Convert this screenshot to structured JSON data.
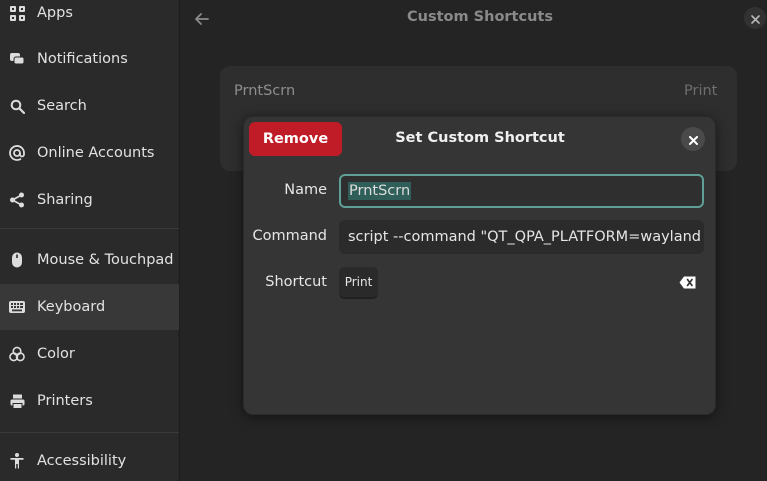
{
  "sidebar": {
    "items": [
      {
        "label": "Apps",
        "icon": "apps-grid-icon"
      },
      {
        "label": "Notifications",
        "icon": "notifications-icon"
      },
      {
        "label": "Search",
        "icon": "search-icon"
      },
      {
        "label": "Online Accounts",
        "icon": "at-sign-icon"
      },
      {
        "label": "Sharing",
        "icon": "share-icon"
      },
      {
        "label": "Mouse & Touchpad",
        "icon": "mouse-icon"
      },
      {
        "label": "Keyboard",
        "icon": "keyboard-icon"
      },
      {
        "label": "Color",
        "icon": "color-icon"
      },
      {
        "label": "Printers",
        "icon": "printer-icon"
      },
      {
        "label": "Accessibility",
        "icon": "accessibility-icon"
      }
    ],
    "active": "Keyboard"
  },
  "header": {
    "title": "Custom Shortcuts"
  },
  "shortcut_list": {
    "rows": [
      {
        "name": "PrntScrn",
        "key": "Print"
      }
    ]
  },
  "dialog": {
    "title": "Set Custom Shortcut",
    "remove_label": "Remove",
    "name_label": "Name",
    "name_value": "PrntScrn",
    "command_label": "Command",
    "command_value": "script --command \"QT_QPA_PLATFORM=wayland fla",
    "shortcut_label": "Shortcut",
    "shortcut_value": "Print"
  },
  "colors": {
    "accent_focus": "#5f9f96",
    "destructive": "#c01c28"
  }
}
